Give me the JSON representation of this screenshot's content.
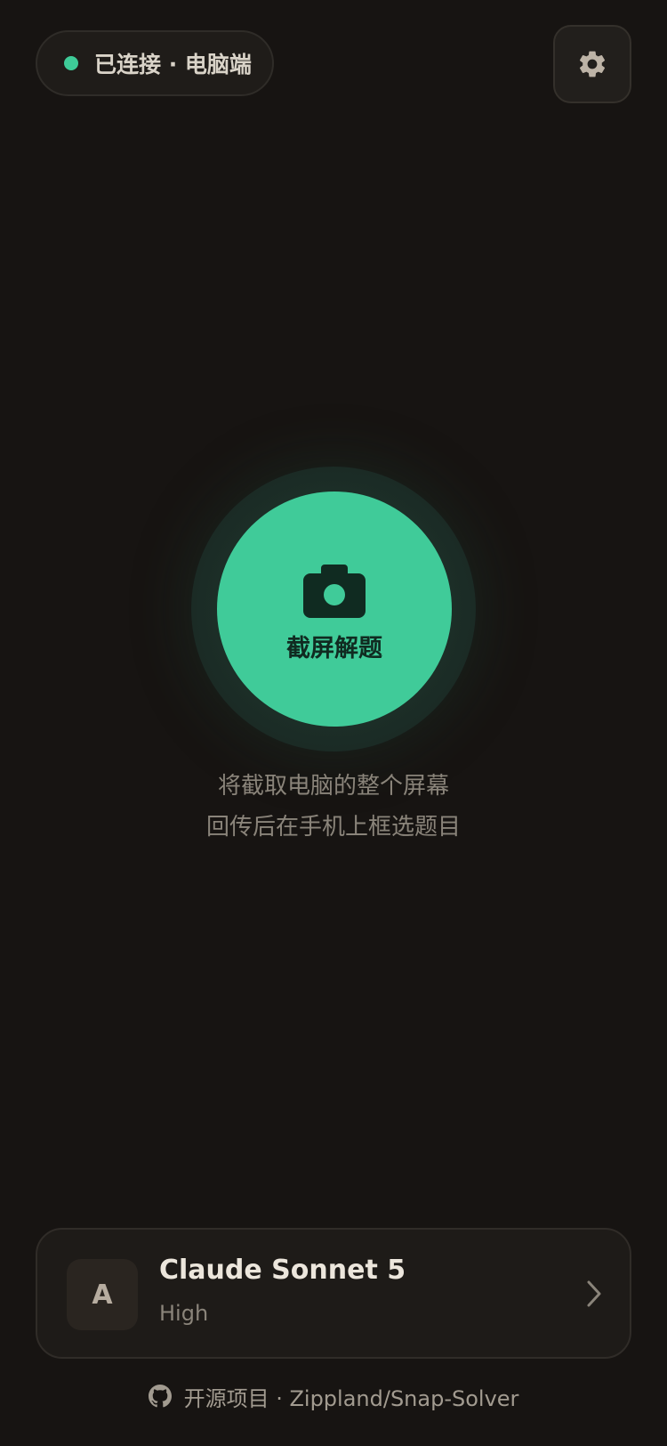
{
  "status": {
    "text": "已连接 · 电脑端",
    "dot_color": "#3ecb98"
  },
  "settings": {
    "icon": "gear-icon"
  },
  "capture": {
    "label": "截屏解题",
    "icon": "camera-icon",
    "accent_color": "#40cb99"
  },
  "hint": {
    "line1": "将截取电脑的整个屏幕",
    "line2": "回传后在手机上框选题目"
  },
  "model": {
    "avatar_letter": "A",
    "name": "Claude Sonnet 5",
    "level": "High",
    "chevron_icon": "chevron-right-icon"
  },
  "footer": {
    "icon": "github-icon",
    "text": "开源项目 · Zippland/Snap-Solver"
  }
}
